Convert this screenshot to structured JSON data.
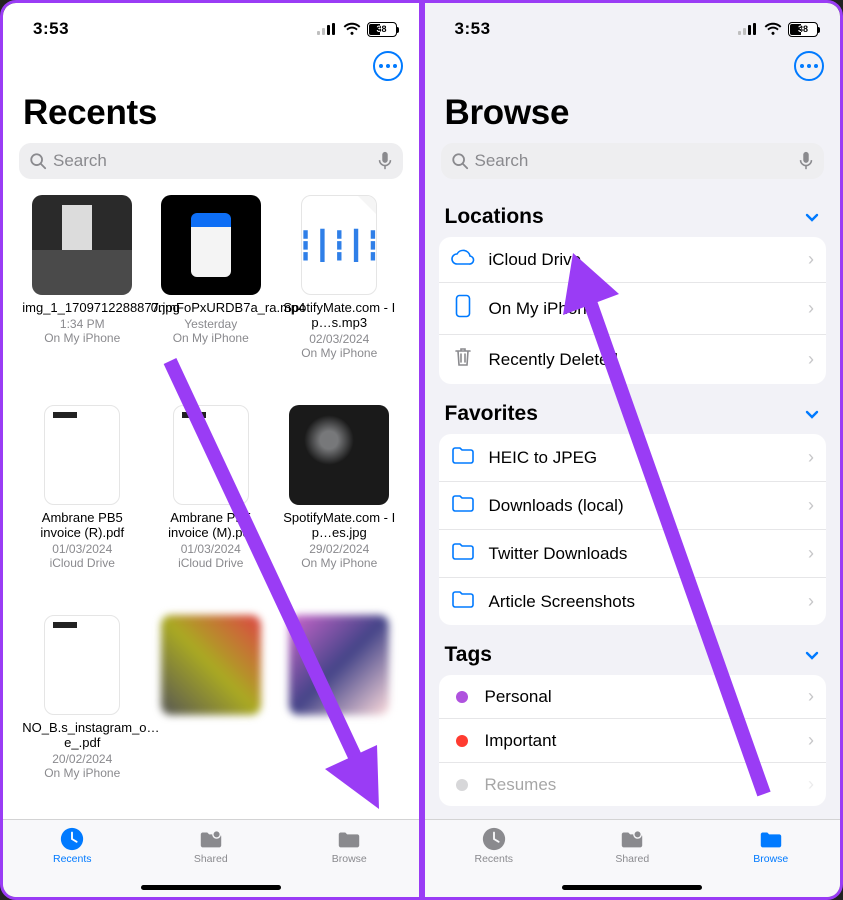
{
  "status": {
    "time": "3:53",
    "battery": "38"
  },
  "more_aria": "More",
  "left": {
    "title": "Recents",
    "search_placeholder": "Search",
    "files": [
      {
        "name": "img_1_1709712288877.jpg",
        "meta": "1:34 PM",
        "loc": "On My iPhone"
      },
      {
        "name": "0nmFoPxURDB7a_ra.mp4",
        "meta": "Yesterday",
        "loc": "On My iPhone"
      },
      {
        "name": "SpotifyMate.com - I p…s.mp3",
        "meta": "02/03/2024",
        "loc": "On My iPhone"
      },
      {
        "name": "Ambrane PB5 invoice (R).pdf",
        "meta": "01/03/2024",
        "loc": "iCloud Drive"
      },
      {
        "name": "Ambrane PB5 invoice (M).pdf",
        "meta": "01/03/2024",
        "loc": "iCloud Drive"
      },
      {
        "name": "SpotifyMate.com - I p…es.jpg",
        "meta": "29/02/2024",
        "loc": "On My iPhone"
      },
      {
        "name": "NO_B.s_instagram_o…e_.pdf",
        "meta": "20/02/2024",
        "loc": "On My iPhone"
      }
    ],
    "tabs": {
      "recents": "Recents",
      "shared": "Shared",
      "browse": "Browse"
    }
  },
  "right": {
    "title": "Browse",
    "search_placeholder": "Search",
    "sections": {
      "locations": {
        "label": "Locations",
        "items": [
          {
            "label": "iCloud Drive"
          },
          {
            "label": "On My iPhone"
          },
          {
            "label": "Recently Deleted"
          }
        ]
      },
      "favorites": {
        "label": "Favorites",
        "items": [
          {
            "label": "HEIC to JPEG"
          },
          {
            "label": "Downloads (local)"
          },
          {
            "label": "Twitter Downloads"
          },
          {
            "label": "Article Screenshots"
          }
        ]
      },
      "tags": {
        "label": "Tags",
        "items": [
          {
            "label": "Personal",
            "color": "#af52de"
          },
          {
            "label": "Important",
            "color": "#ff3b30"
          },
          {
            "label": "Resumes",
            "color": "#8e8e93"
          }
        ]
      }
    },
    "tabs": {
      "recents": "Recents",
      "shared": "Shared",
      "browse": "Browse"
    }
  }
}
